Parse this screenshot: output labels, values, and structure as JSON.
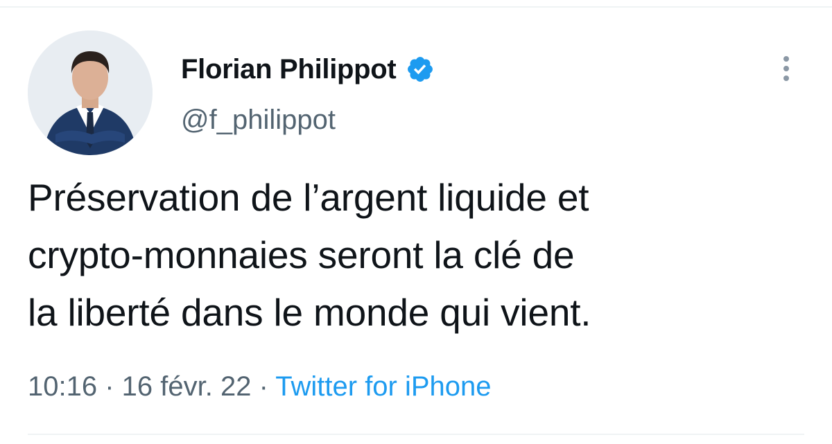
{
  "author": {
    "display_name": "Florian Philippot",
    "handle": "@f_philippot",
    "verified": true,
    "verified_icon": "verified-badge-icon",
    "avatar_description_icon": "avatar-photo"
  },
  "tweet": {
    "lines": [
      "Préservation de l’argent liquide et",
      "crypto-monnaies seront la clé de",
      "la liberté dans le monde qui vient."
    ]
  },
  "meta": {
    "time": "10:16",
    "separator_1": " · ",
    "date": "16 févr. 22",
    "separator_2": " · ",
    "source": "Twitter for iPhone"
  },
  "menu": {
    "icon": "more-vertical-icon"
  },
  "colors": {
    "text_primary": "#0f1419",
    "text_secondary": "#536471",
    "link_blue": "#1d9bf0",
    "verified_blue": "#1d9bf0",
    "divider": "#eff3f4"
  }
}
